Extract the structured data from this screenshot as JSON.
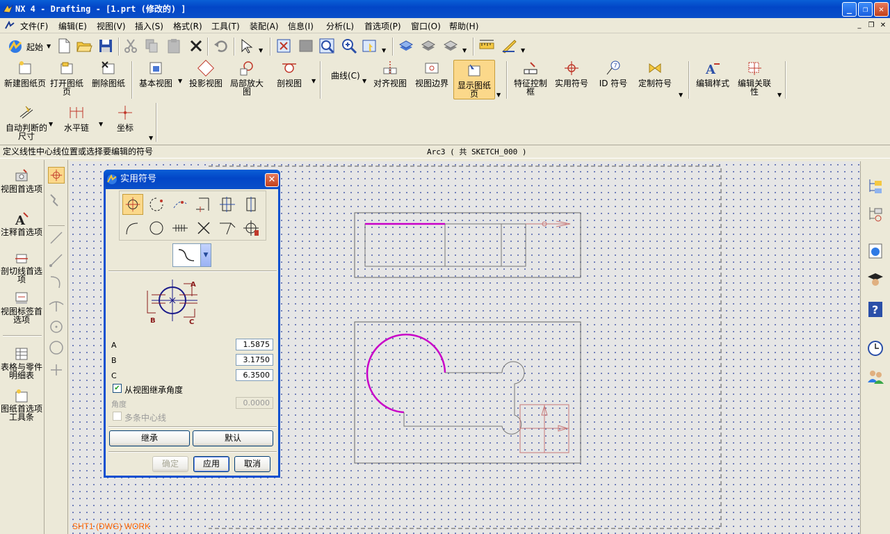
{
  "title": "NX 4 - Drafting - [1.prt  (修改的) ]",
  "menu": [
    "文件(F)",
    "编辑(E)",
    "视图(V)",
    "插入(S)",
    "格式(R)",
    "工具(T)",
    "装配(A)",
    "信息(I)",
    "分析(L)",
    "首选项(P)",
    "窗口(O)",
    "帮助(H)"
  ],
  "toolbar": {
    "start_label": "起始"
  },
  "ribbon1": {
    "new_sheet": "新建图纸页",
    "open_sheet": "打开图纸页",
    "delete_sheet": "删除图纸",
    "base_view": "基本视图",
    "proj_view": "投影视图",
    "detail_view": "局部放大图",
    "section_view": "剖视图",
    "curve": "曲线(C)",
    "align_view": "对齐视图",
    "view_boundary": "视图边界",
    "display_sheet": "显示图纸页",
    "fcf": "特征控制框",
    "utility_symbol": "实用符号",
    "id_symbol": "ID 符号",
    "custom_symbol": "定制符号",
    "edit_style": "编辑样式",
    "edit_assoc": "编辑关联性"
  },
  "ribbon2": {
    "auto_dim": "自动判断的尺寸",
    "horiz_chain": "水平链",
    "ordinate": "坐标"
  },
  "cue": {
    "prompt": "定义线性中心线位置或选择要编辑的符号",
    "status": "Arc3 ( 共 SKETCH_000 )"
  },
  "left_panel": [
    "视图首选项",
    "注释首选项",
    "剖切线首选项",
    "视图标签首选项",
    "表格与零件明细表",
    "图纸首选项工具条"
  ],
  "sheet_label": "SHT1 (DWG) WORK",
  "dialog": {
    "title": "实用符号",
    "fields": {
      "a_label": "A",
      "a_value": "1.5875",
      "b_label": "B",
      "b_value": "3.1750",
      "c_label": "C",
      "c_value": "6.3500"
    },
    "inherit_angle": "从视图继承角度",
    "angle_label": "角度",
    "angle_value": "0.0000",
    "multi_centerline": "多条中心线",
    "btn_inherit": "继承",
    "btn_default": "默认",
    "btn_ok": "确定",
    "btn_apply": "应用",
    "btn_cancel": "取消",
    "diagram_labels": {
      "a": "A",
      "b": "B",
      "c": "C"
    }
  },
  "colors": {
    "title_blue": "#0a4fc9",
    "highlight": "#c800c8",
    "sheet_label": "#ff6600"
  }
}
